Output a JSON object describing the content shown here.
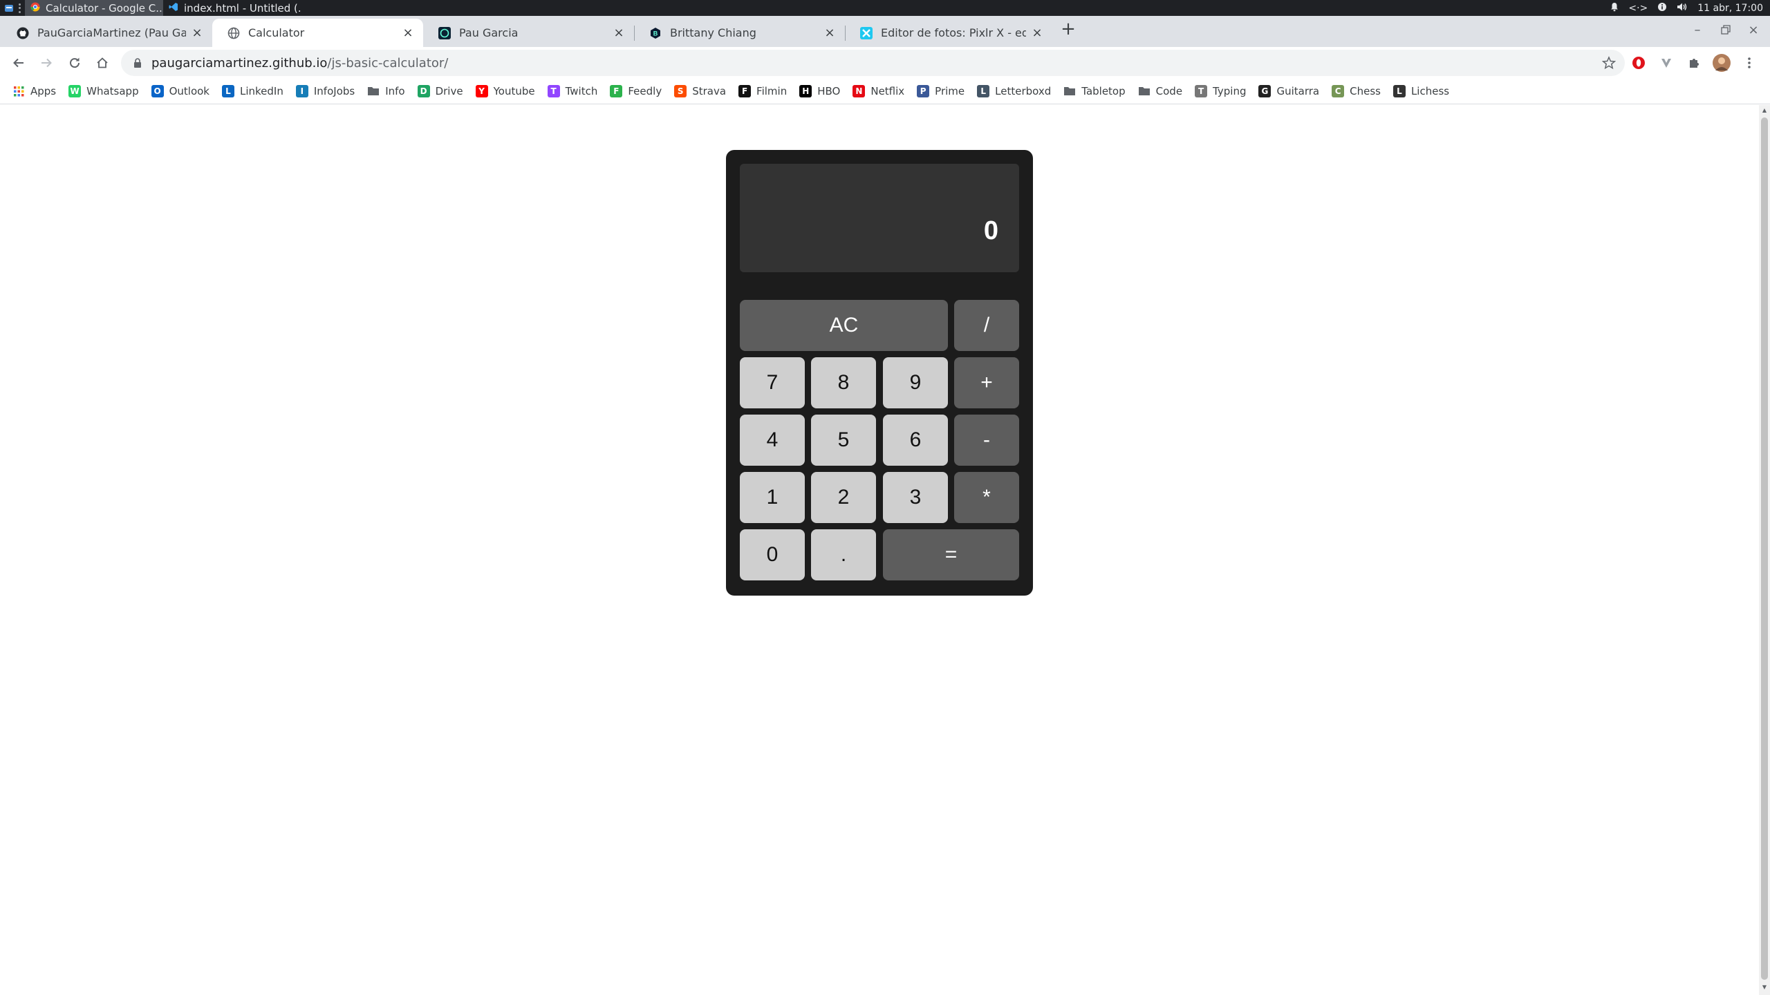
{
  "os": {
    "tasks": [
      {
        "label": "Calculator - Google C...",
        "active": true
      },
      {
        "label": "index.html - Untitled (...",
        "active": false
      }
    ],
    "datetime": "11 abr, 17:00"
  },
  "tabs": [
    {
      "title": "PauGarciaMartinez (Pau Garcia",
      "icon": "github-icon",
      "active": false
    },
    {
      "title": "Calculator",
      "icon": "globe-icon",
      "active": true
    },
    {
      "title": "Pau Garcia",
      "icon": "site-p-icon",
      "active": false
    },
    {
      "title": "Brittany Chiang",
      "icon": "site-b-icon",
      "active": false
    },
    {
      "title": "Editor de fotos: Pixlr X - edición",
      "icon": "pixlr-icon",
      "active": false
    }
  ],
  "address": {
    "host": "paugarciamartinez.github.io",
    "path": "/js-basic-calculator/"
  },
  "bookmarks": [
    {
      "label": "Apps",
      "icon": "apps-grid-icon",
      "color": "#ea4335"
    },
    {
      "label": "Whatsapp",
      "icon": "whatsapp-icon",
      "color": "#25d366"
    },
    {
      "label": "Outlook",
      "icon": "outlook-icon",
      "color": "#0a64c8"
    },
    {
      "label": "LinkedIn",
      "icon": "linkedin-icon",
      "color": "#0a66c2"
    },
    {
      "label": "InfoJobs",
      "icon": "infojobs-icon",
      "color": "#167db7"
    },
    {
      "label": "Info",
      "icon": "folder-icon",
      "color": "#5f6368"
    },
    {
      "label": "Drive",
      "icon": "drive-icon",
      "color": "#1fa463"
    },
    {
      "label": "Youtube",
      "icon": "youtube-icon",
      "color": "#ff0000"
    },
    {
      "label": "Twitch",
      "icon": "twitch-icon",
      "color": "#9146ff"
    },
    {
      "label": "Feedly",
      "icon": "feedly-icon",
      "color": "#2bb24c"
    },
    {
      "label": "Strava",
      "icon": "strava-icon",
      "color": "#fc4c02"
    },
    {
      "label": "Filmin",
      "icon": "filmin-icon",
      "color": "#111111"
    },
    {
      "label": "HBO",
      "icon": "hbo-icon",
      "color": "#000000"
    },
    {
      "label": "Netflix",
      "icon": "netflix-icon",
      "color": "#e50914"
    },
    {
      "label": "Prime",
      "icon": "prime-icon",
      "color": "#3b5998"
    },
    {
      "label": "Letterboxd",
      "icon": "letterboxd-icon",
      "color": "#445566"
    },
    {
      "label": "Tabletop",
      "icon": "folder-icon",
      "color": "#5f6368"
    },
    {
      "label": "Code",
      "icon": "folder-icon",
      "color": "#5f6368"
    },
    {
      "label": "Typing",
      "icon": "typing-icon",
      "color": "#777777"
    },
    {
      "label": "Guitarra",
      "icon": "guitar-icon",
      "color": "#222222"
    },
    {
      "label": "Chess",
      "icon": "chess-icon",
      "color": "#769656"
    },
    {
      "label": "Lichess",
      "icon": "lichess-icon",
      "color": "#333333"
    }
  ],
  "calculator": {
    "display": "0",
    "keys": {
      "ac": "AC",
      "divide": "/",
      "add": "+",
      "subtract": "-",
      "multiply": "*",
      "equals": "=",
      "decimal": ".",
      "n0": "0",
      "n1": "1",
      "n2": "2",
      "n3": "3",
      "n4": "4",
      "n5": "5",
      "n6": "6",
      "n7": "7",
      "n8": "8",
      "n9": "9"
    }
  }
}
